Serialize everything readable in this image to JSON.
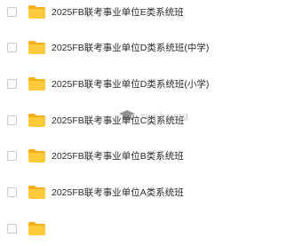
{
  "files": [
    {
      "name": "2025FB联考事业单位E类系统班",
      "type": "folder",
      "checked": false
    },
    {
      "name": "2025FB联考事业单位D类系统班(中学)",
      "type": "folder",
      "checked": false
    },
    {
      "name": "2025FB联考事业单位D类系统班(小学)",
      "type": "folder",
      "checked": false
    },
    {
      "name": "2025FB联考事业单位C类系统班",
      "type": "folder",
      "checked": false
    },
    {
      "name": "2025FB联考事业单位B类系统班",
      "type": "folder",
      "checked": false
    },
    {
      "name": "2025FB联考事业单位A类系统班",
      "type": "folder",
      "checked": false
    },
    {
      "name": "",
      "type": "folder",
      "checked": false
    }
  ],
  "watermark": {
    "text": "xue-ba.org",
    "icon": "graduation-cap-icon"
  },
  "colors": {
    "folder_body": "#FFCB3D",
    "folder_tab": "#F5B019",
    "text": "#2b2b2b"
  }
}
